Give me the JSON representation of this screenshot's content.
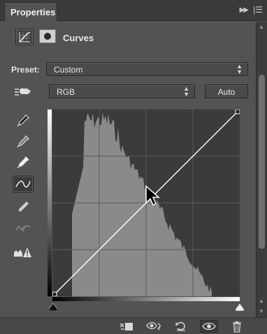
{
  "panel": {
    "tab_title": "Properties",
    "title": "Curves"
  },
  "preset": {
    "label": "Preset:",
    "value": "Custom"
  },
  "channel": {
    "value": "RGB"
  },
  "auto_button": {
    "label": "Auto"
  },
  "tools": [
    "on-image-adjust-icon",
    "black-point-eyedropper-icon",
    "gray-point-eyedropper-icon",
    "white-point-eyedropper-icon",
    "edit-points-curve-icon",
    "pencil-draw-icon",
    "smooth-curve-icon",
    "clipping-warning-icon"
  ],
  "graph": {
    "grid_divisions": 4,
    "input_range": [
      0,
      255
    ],
    "output_range": [
      0,
      255
    ],
    "curve_points": [
      [
        0,
        0
      ],
      [
        128,
        128
      ],
      [
        255,
        255
      ]
    ],
    "colors": {
      "background": "#3b3b3b",
      "histogram": "#8a8a8a",
      "grid": "#5a5a5a",
      "curve": "#ffffff"
    }
  },
  "bottom_toolbar": [
    "clip-to-layer-icon",
    "view-previous-state-icon",
    "reset-adjustment-icon",
    "toggle-visibility-icon",
    "delete-layer-icon"
  ]
}
